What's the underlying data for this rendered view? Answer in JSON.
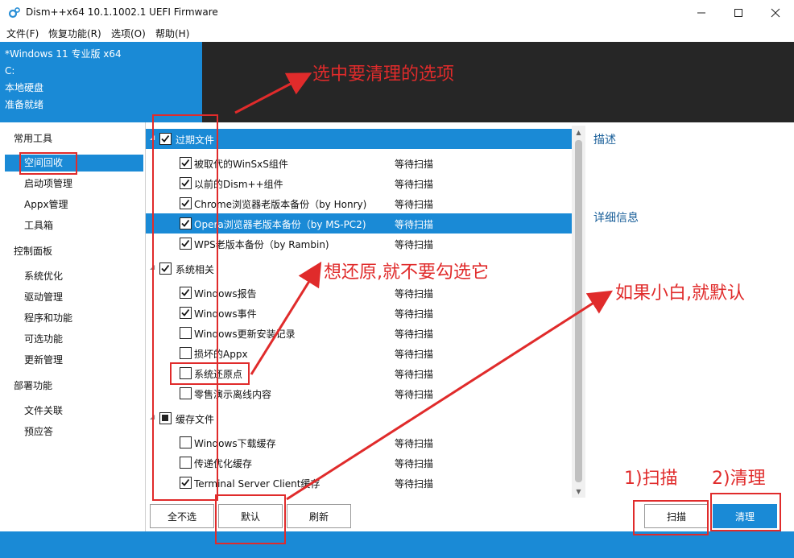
{
  "window": {
    "title": "Dism++x64 10.1.1002.1 UEFI Firmware",
    "controls": [
      "minimize-icon",
      "maximize-icon",
      "close-icon"
    ]
  },
  "menu": [
    "文件(F)",
    "恢复功能(R)",
    "选项(O)",
    "帮助(H)"
  ],
  "info": {
    "os": "*Windows 11 专业版 x64",
    "drive": "C:",
    "disk": "本地硬盘",
    "status": "准备就绪"
  },
  "sidebar": {
    "sections": [
      {
        "title": "常用工具",
        "items": [
          "空间回收",
          "启动项管理",
          "Appx管理",
          "工具箱"
        ]
      },
      {
        "title": "控制面板",
        "items": [
          "系统优化",
          "驱动管理",
          "程序和功能",
          "可选功能",
          "更新管理"
        ]
      },
      {
        "title": "部署功能",
        "items": [
          "文件关联",
          "预应答"
        ]
      }
    ],
    "selected": "空间回收"
  },
  "list": {
    "groups": [
      {
        "label": "过期文件",
        "state": "checked",
        "selected": true,
        "items": [
          {
            "label": "被取代的WinSxS组件",
            "checked": true,
            "status": "等待扫描"
          },
          {
            "label": "以前的Dism++组件",
            "checked": true,
            "status": "等待扫描"
          },
          {
            "label": "Chrome浏览器老版本备份（by Honry)",
            "checked": true,
            "status": "等待扫描"
          },
          {
            "label": "Opera浏览器老版本备份（by MS-PC2)",
            "checked": true,
            "status": "等待扫描",
            "selected": true
          },
          {
            "label": "WPS老版本备份（by Rambin)",
            "checked": true,
            "status": "等待扫描"
          }
        ]
      },
      {
        "label": "系统相关",
        "state": "checked",
        "items": [
          {
            "label": "Windows报告",
            "checked": true,
            "status": "等待扫描"
          },
          {
            "label": "Windows事件",
            "checked": true,
            "status": "等待扫描"
          },
          {
            "label": "Windows更新安装记录",
            "checked": false,
            "status": "等待扫描"
          },
          {
            "label": "损坏的Appx",
            "checked": false,
            "status": "等待扫描"
          },
          {
            "label": "系统还原点",
            "checked": false,
            "status": "等待扫描"
          },
          {
            "label": "零售演示离线内容",
            "checked": false,
            "status": "等待扫描"
          }
        ]
      },
      {
        "label": "缓存文件",
        "state": "partial",
        "items": [
          {
            "label": "Windows下载缓存",
            "checked": false,
            "status": "等待扫描"
          },
          {
            "label": "传递优化缓存",
            "checked": false,
            "status": "等待扫描"
          },
          {
            "label": "Terminal Server Client缓存",
            "checked": true,
            "status": "等待扫描"
          }
        ]
      }
    ]
  },
  "description": {
    "title": "描述",
    "detail_title": "详细信息"
  },
  "buttons": {
    "deselect_all": "全不选",
    "default": "默认",
    "refresh": "刷新",
    "scan": "扫描",
    "clean": "清理"
  },
  "annotations": {
    "select": "选中要清理的选项",
    "restore": "想还原,就不要勾选它",
    "beginner": "如果小白,就默认",
    "step1": "1)扫描",
    "step2": "2)清理"
  },
  "colors": {
    "accent": "#1a8ad6",
    "annotation": "#e02b2b",
    "dark": "#262626"
  }
}
